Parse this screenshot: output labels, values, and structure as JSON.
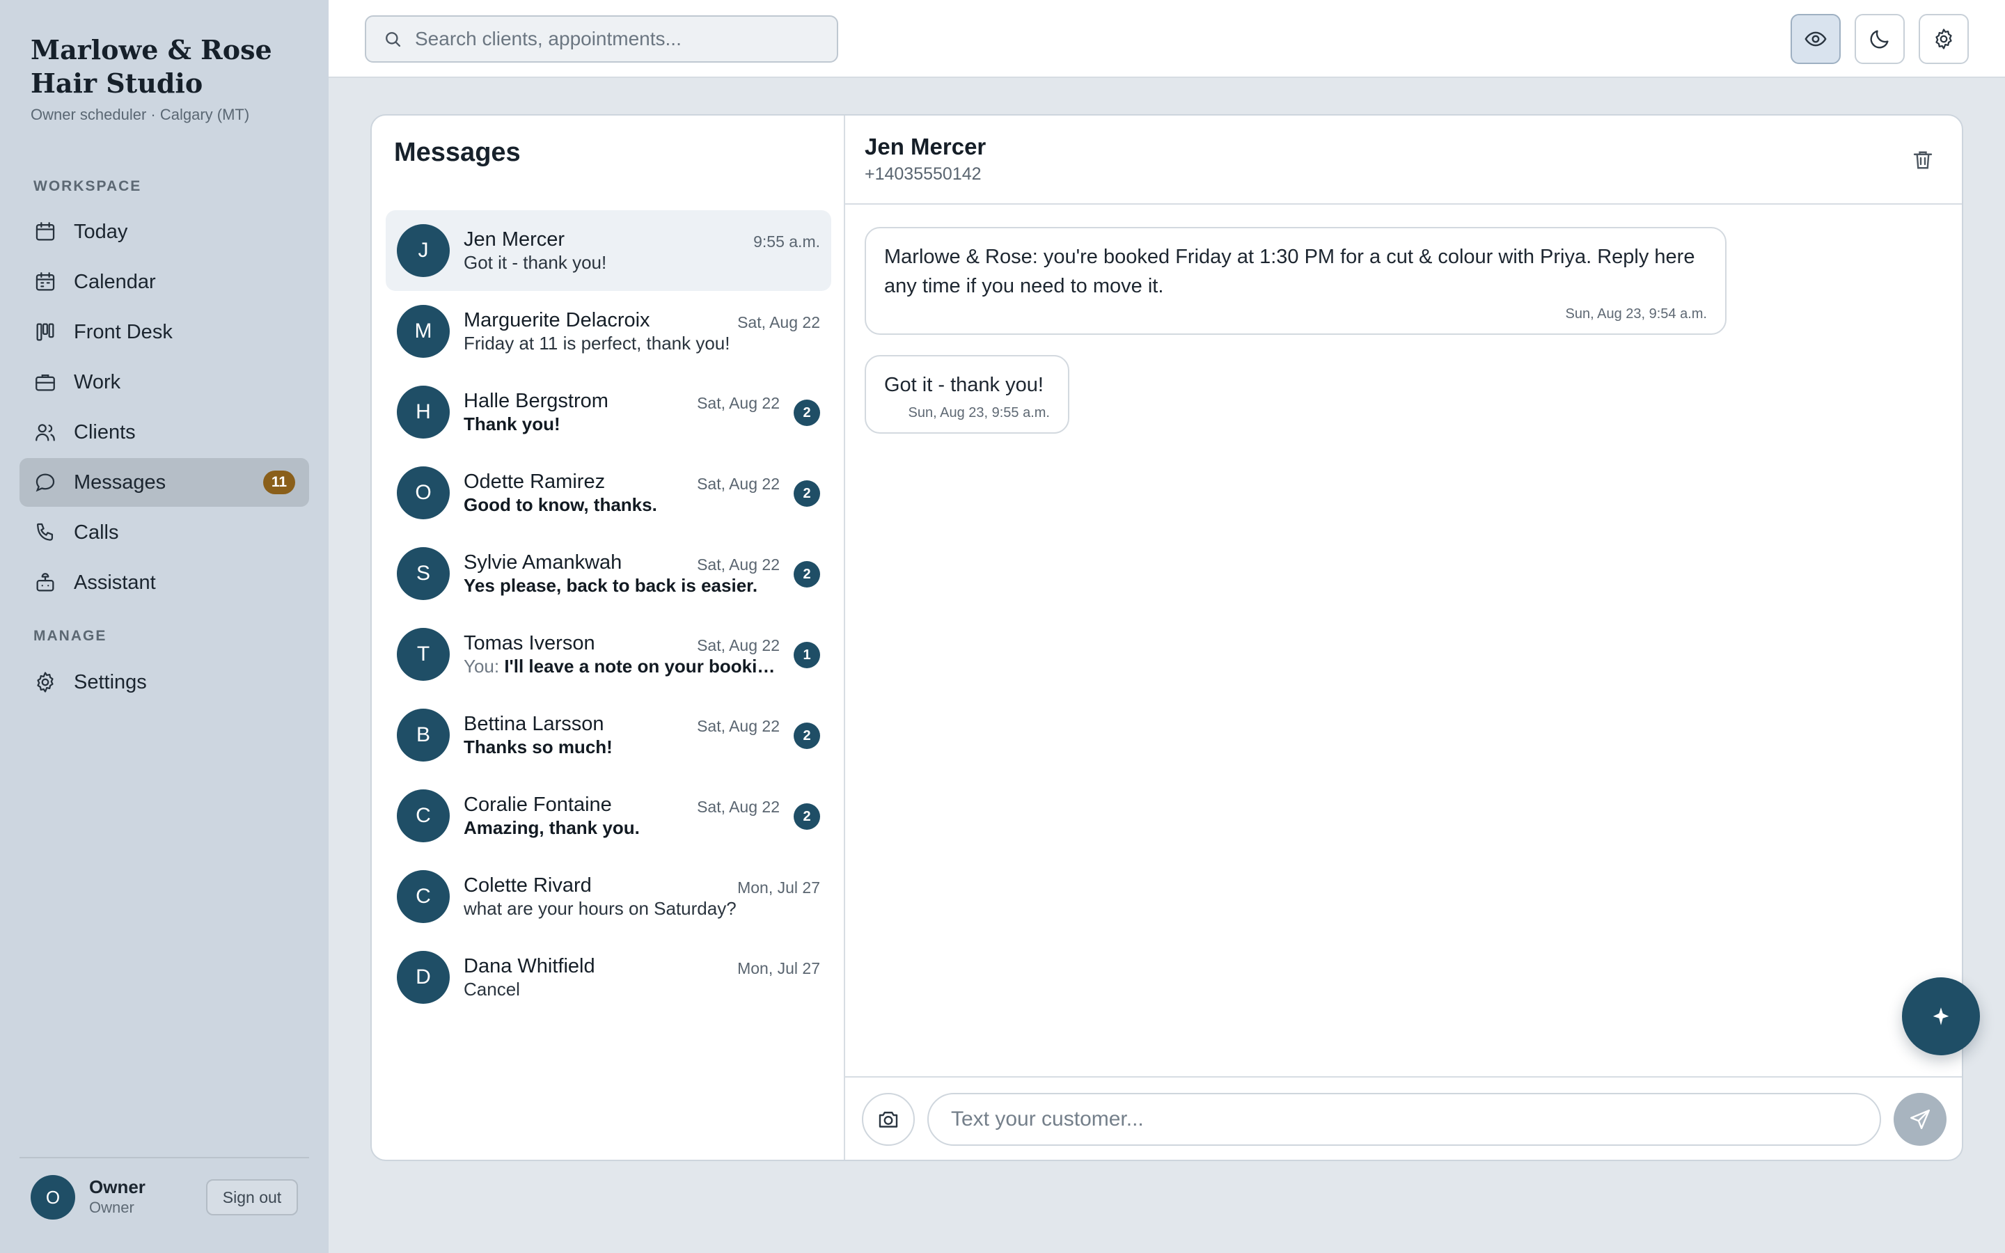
{
  "brand": {
    "title": "Marlowe & Rose Hair Studio",
    "subtitle": "Owner scheduler · Calgary (MT)"
  },
  "sidebar": {
    "workspace_label": "WORKSPACE",
    "manage_label": "MANAGE",
    "items": [
      {
        "label": "Today",
        "icon": "calendar-day-icon"
      },
      {
        "label": "Calendar",
        "icon": "calendar-icon"
      },
      {
        "label": "Front Desk",
        "icon": "kanban-icon"
      },
      {
        "label": "Work",
        "icon": "briefcase-icon"
      },
      {
        "label": "Clients",
        "icon": "users-icon"
      },
      {
        "label": "Messages",
        "icon": "chat-bubble-icon",
        "badge": "11",
        "active": true
      },
      {
        "label": "Calls",
        "icon": "phone-icon"
      },
      {
        "label": "Assistant",
        "icon": "bot-icon"
      }
    ],
    "manage_items": [
      {
        "label": "Settings",
        "icon": "gear-icon"
      }
    ],
    "user": {
      "initial": "O",
      "name": "Owner",
      "role": "Owner",
      "signout_label": "Sign out"
    }
  },
  "topbar": {
    "search_placeholder": "Search clients, appointments...",
    "buttons": [
      "eye-icon",
      "moon-icon",
      "gear-icon"
    ]
  },
  "messages": {
    "title": "Messages",
    "conversations": [
      {
        "initial": "J",
        "name": "Jen Mercer",
        "time": "9:55 a.m.",
        "preview": "Got it - thank you!",
        "unread": "",
        "active": true
      },
      {
        "initial": "M",
        "name": "Marguerite Delacroix",
        "time": "Sat, Aug 22",
        "preview": "Friday at 11 is perfect, thank you!",
        "unread": ""
      },
      {
        "initial": "H",
        "name": "Halle Bergstrom",
        "time": "Sat, Aug 22",
        "preview": "Thank you!",
        "unread": "2"
      },
      {
        "initial": "O",
        "name": "Odette Ramirez",
        "time": "Sat, Aug 22",
        "preview": "Good to know, thanks.",
        "unread": "2"
      },
      {
        "initial": "S",
        "name": "Sylvie Amankwah",
        "time": "Sat, Aug 22",
        "preview": "Yes please, back to back is easier.",
        "unread": "2"
      },
      {
        "initial": "T",
        "name": "Tomas Iverson",
        "time": "Sat, Aug 22",
        "prefix": "You: ",
        "preview": "I'll leave a note on your booking",
        "unread": "1"
      },
      {
        "initial": "B",
        "name": "Bettina Larsson",
        "time": "Sat, Aug 22",
        "preview": "Thanks so much!",
        "unread": "2"
      },
      {
        "initial": "C",
        "name": "Coralie Fontaine",
        "time": "Sat, Aug 22",
        "preview": "Amazing, thank you.",
        "unread": "2"
      },
      {
        "initial": "C",
        "name": "Colette Rivard",
        "time": "Mon, Jul 27",
        "preview": "what are your hours on Saturday?",
        "unread": ""
      },
      {
        "initial": "D",
        "name": "Dana Whitfield",
        "time": "Mon, Jul 27",
        "preview": "Cancel",
        "unread": ""
      }
    ]
  },
  "chat": {
    "name": "Jen Mercer",
    "phone": "+14035550142",
    "messages": [
      {
        "text": "Marlowe & Rose: you're booked Friday at 1:30 PM for a cut & colour with Priya. Reply here any time if you need to move it.",
        "time": "Sun, Aug 23, 9:54 a.m."
      },
      {
        "text": "Got it - thank you!",
        "time": "Sun, Aug 23, 9:55 a.m."
      }
    ],
    "composer_placeholder": "Text your customer..."
  },
  "colors": {
    "accent": "#1f4e66",
    "badge": "#8a5f1a",
    "sidebar_bg": "#cdd6e0"
  }
}
